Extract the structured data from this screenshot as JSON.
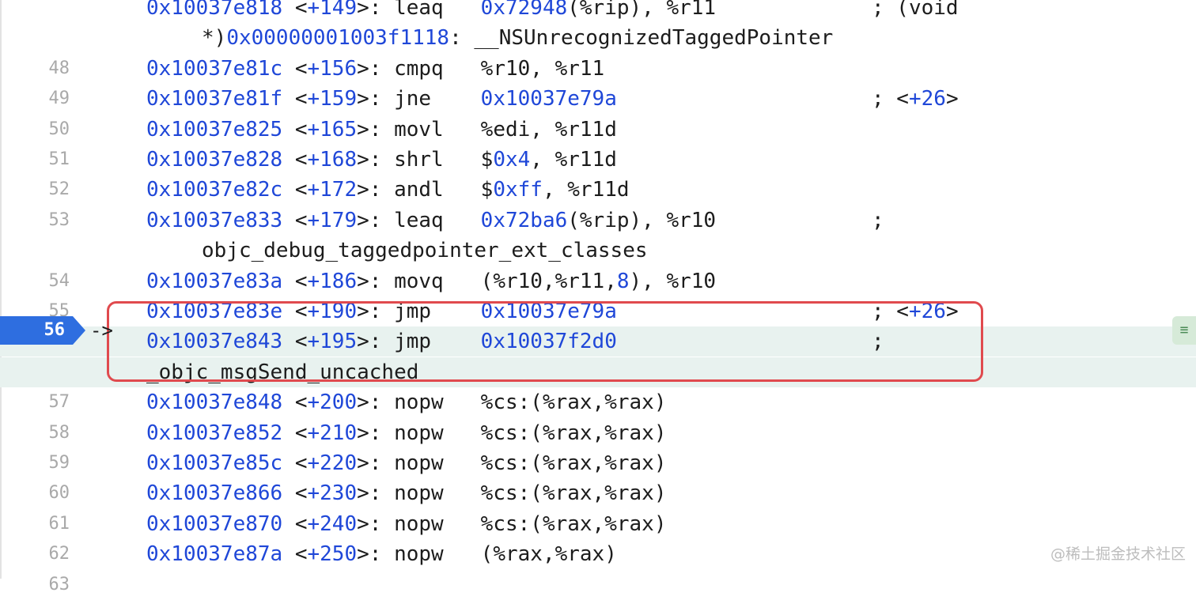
{
  "editor": {
    "current_line": "56",
    "pc_arrow": "->",
    "watermark": "@稀土掘金技术社区",
    "side_handle_icon": "menu-lines-icon",
    "lines": [
      {
        "ln": "",
        "addr": "0x10037e818",
        "off": "<+149>:",
        "op": "leaq",
        "args": "0x72948(%rip), %r11",
        "trail": "; (void"
      },
      {
        "ln": "",
        "cont": "*)0x00000001003f1118: __NSUnrecognizedTaggedPointer"
      },
      {
        "ln": "48",
        "addr": "0x10037e81c",
        "off": "<+156>:",
        "op": "cmpq",
        "args": "%r10, %r11"
      },
      {
        "ln": "49",
        "addr": "0x10037e81f",
        "off": "<+159>:",
        "op": "jne",
        "args": "0x10037e79a",
        "trail": "; <+26>"
      },
      {
        "ln": "50",
        "addr": "0x10037e825",
        "off": "<+165>:",
        "op": "movl",
        "args": "%edi, %r11d"
      },
      {
        "ln": "51",
        "addr": "0x10037e828",
        "off": "<+168>:",
        "op": "shrl",
        "args": "$0x4, %r11d"
      },
      {
        "ln": "52",
        "addr": "0x10037e82c",
        "off": "<+172>:",
        "op": "andl",
        "args": "$0xff, %r11d"
      },
      {
        "ln": "53",
        "addr": "0x10037e833",
        "off": "<+179>:",
        "op": "leaq",
        "args": "0x72ba6(%rip), %r10",
        "trail": ";"
      },
      {
        "ln": "",
        "cont": "objc_debug_taggedpointer_ext_classes"
      },
      {
        "ln": "54",
        "addr": "0x10037e83a",
        "off": "<+186>:",
        "op": "movq",
        "args": "(%r10,%r11,8), %r10"
      },
      {
        "ln": "55",
        "addr": "0x10037e83e",
        "off": "<+190>:",
        "op": "jmp",
        "args": "0x10037e79a",
        "trail": "; <+26>"
      },
      {
        "ln": "56",
        "addr": "0x10037e843",
        "off": "<+195>:",
        "op": "jmp",
        "args": "0x10037f2d0",
        "trail": ";",
        "current": true
      },
      {
        "ln": "",
        "cont2": "_objc_msgSend_uncached",
        "current": true
      },
      {
        "ln": "57",
        "addr": "0x10037e848",
        "off": "<+200>:",
        "op": "nopw",
        "args": "%cs:(%rax,%rax)"
      },
      {
        "ln": "58",
        "addr": "0x10037e852",
        "off": "<+210>:",
        "op": "nopw",
        "args": "%cs:(%rax,%rax)"
      },
      {
        "ln": "59",
        "addr": "0x10037e85c",
        "off": "<+220>:",
        "op": "nopw",
        "args": "%cs:(%rax,%rax)"
      },
      {
        "ln": "60",
        "addr": "0x10037e866",
        "off": "<+230>:",
        "op": "nopw",
        "args": "%cs:(%rax,%rax)"
      },
      {
        "ln": "61",
        "addr": "0x10037e870",
        "off": "<+240>:",
        "op": "nopw",
        "args": "%cs:(%rax,%rax)"
      },
      {
        "ln": "62",
        "addr": "0x10037e87a",
        "off": "<+250>:",
        "op": "nopw",
        "args": "(%rax,%rax)"
      },
      {
        "ln": "63",
        "addr": "",
        "off": "",
        "op": "",
        "args": ""
      }
    ]
  }
}
